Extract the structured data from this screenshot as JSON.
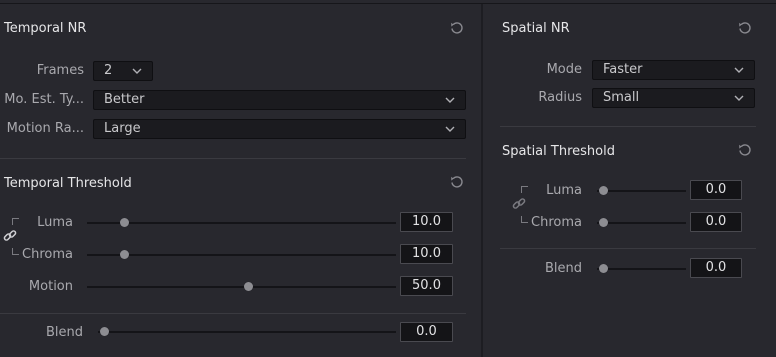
{
  "temporal_nr": {
    "title": "Temporal NR",
    "frames": {
      "label": "Frames",
      "value": "2"
    },
    "motion_est_type": {
      "label": "Mo. Est. Ty...",
      "value": "Better"
    },
    "motion_range": {
      "label": "Motion Ra...",
      "value": "Large"
    }
  },
  "temporal_threshold": {
    "title": "Temporal Threshold",
    "luma": {
      "label": "Luma",
      "value": "10.0",
      "level": 0.1
    },
    "chroma": {
      "label": "Chroma",
      "value": "10.0",
      "level": 0.1
    },
    "motion": {
      "label": "Motion",
      "value": "50.0",
      "level": 0.5
    },
    "blend": {
      "label": "Blend",
      "value": "0.0",
      "level": 0.0
    }
  },
  "spatial_nr": {
    "title": "Spatial NR",
    "mode": {
      "label": "Mode",
      "value": "Faster"
    },
    "radius": {
      "label": "Radius",
      "value": "Small"
    }
  },
  "spatial_threshold": {
    "title": "Spatial Threshold",
    "luma": {
      "label": "Luma",
      "value": "0.0",
      "level": 0.0
    },
    "chroma": {
      "label": "Chroma",
      "value": "0.0",
      "level": 0.0
    },
    "blend": {
      "label": "Blend",
      "value": "0.0",
      "level": 0.0
    }
  },
  "icons": {
    "reset": "reset-icon",
    "dropdown": "chevron-down-icon",
    "link": "link-icon"
  },
  "colors": {
    "background": "#28282e",
    "field": "#1b1b1f",
    "knob": "#8d8d92"
  }
}
